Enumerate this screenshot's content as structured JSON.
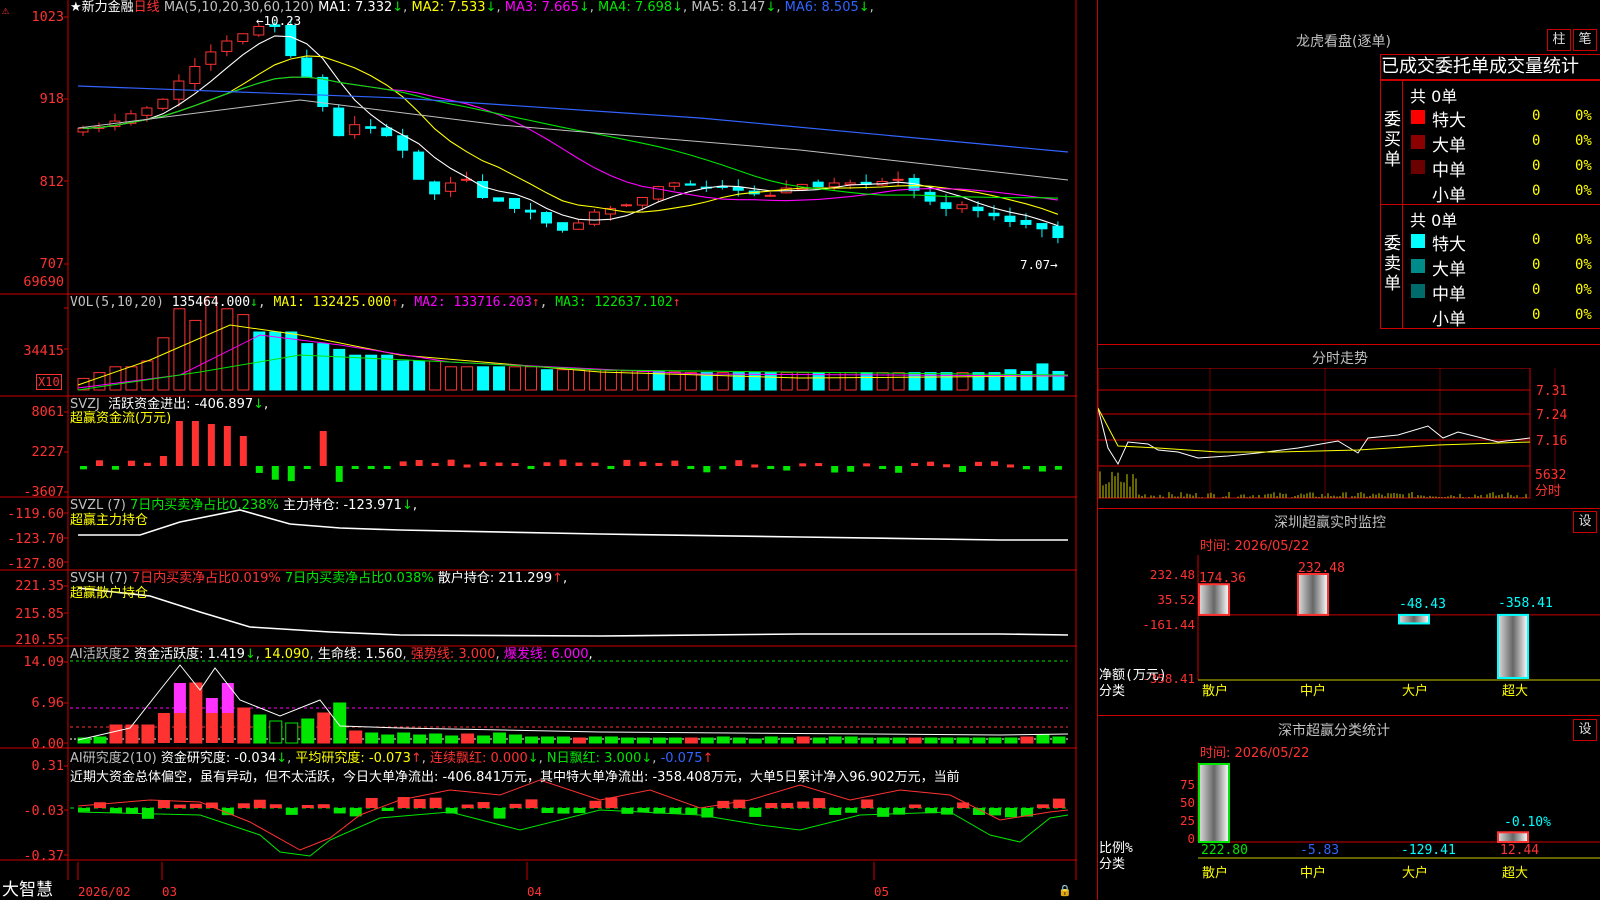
{
  "stock": {
    "star": "★",
    "name": "新力金融",
    "period": "日线"
  },
  "main": {
    "ma_title": "MA(5,10,20,30,60,120)",
    "ma": [
      {
        "label": "MA1: 7.332",
        "arrow": "↓",
        "color": "#ffffff"
      },
      {
        "label": "MA2: 7.533",
        "arrow": "↓",
        "color": "#ffff00"
      },
      {
        "label": "MA3: 7.665",
        "arrow": "↓",
        "color": "#ff00ff"
      },
      {
        "label": "MA4: 7.698",
        "arrow": "↓",
        "color": "#00e600"
      },
      {
        "label": "MA5: 8.147",
        "arrow": "↓",
        "color": "#c0c0c0"
      },
      {
        "label": "MA6: 8.505",
        "arrow": "↓",
        "color": "#3264ff"
      }
    ],
    "y_ticks": [
      "1023",
      "918",
      "812",
      "707"
    ],
    "high_label": "10.23",
    "low_label": "7.07",
    "corner_icon": "alert-icon"
  },
  "vol": {
    "title": "VOL(5,10,20)",
    "value": "135464.000",
    "v_arrow": "↓",
    "ma1": "MA1: 132425.000",
    "ma1_arrow": "↑",
    "ma2": "MA2: 133716.203",
    "ma2_arrow": "↑",
    "ma3": "MA3: 122637.102",
    "ma3_arrow": "↑",
    "y_ticks": [
      "69690",
      "34415"
    ],
    "unit": "X10"
  },
  "svzj": {
    "title": "SVZJ",
    "label": "活跃资金进出: -406.897",
    "arrow": "↓",
    "suffix": ",",
    "subtitle": "超赢资金流(万元)",
    "y_ticks": [
      "8061",
      "2227",
      "-3607"
    ]
  },
  "svzl": {
    "title": "SVZL (7)",
    "label1": "7日内买卖净占比0.238%",
    "label2": "主力持仓: -123.971",
    "arrow": "↓",
    "suffix": ",",
    "subtitle": "超赢主力持仓",
    "y_ticks": [
      "-119.60",
      "-123.70",
      "-127.80"
    ]
  },
  "svsh": {
    "title": "SVSH (7)",
    "label1": "7日内买卖净占比0.019%",
    "label2": "7日内买卖净占比0.038%",
    "label3": "散户持仓: 211.299",
    "arrow": "↑",
    "suffix": ",",
    "subtitle": "超赢散户持仓",
    "y_ticks": [
      "221.35",
      "215.85",
      "210.55"
    ]
  },
  "ai1": {
    "title": "AI活跃度2",
    "l1": "资金活跃度: 1.419",
    "l1a": "↓",
    "l2": "14.090",
    "l3": "生命线: 1.560",
    "l4": "强势线: 3.000",
    "l5": "爆发线: 6.000",
    "suffix": ",",
    "y_ticks": [
      "14.09",
      "6.96",
      "0.00"
    ]
  },
  "ai2": {
    "title": "AI研究度2(10)",
    "l1": "资金研究度: -0.034",
    "l1a": "↓",
    "l2": "平均研究度: -0.073",
    "l2a": "↑",
    "l3": "连续飘红: 0.000",
    "l3a": "↓",
    "l4": "N日飘红: 3.000",
    "l4a": "↓",
    "l5": "-0.075",
    "l5a": "↑",
    "note": "近期大资金总体偏空，虽有异动，但不太活跃，今日大单净流出: -406.841万元，其中特大单净流出: -358.408万元，大单5日累计净入96.902万元，当前",
    "y_ticks": [
      "0.31",
      "-0.03",
      "-0.37"
    ]
  },
  "xaxis": {
    "brand": "大智慧",
    "labels": [
      "2026/02",
      "03",
      "04",
      "05"
    ]
  },
  "right": {
    "lhb_title": "龙虎看盘(逐单)",
    "btn_bar": "柱",
    "btn_bi": "笔",
    "tab_text": "已成交委托单成交量统计",
    "buy_side": "委买单",
    "sell_side": "委卖单",
    "buy_total": "共 0单",
    "sell_total": "共 0单",
    "buy_rows": [
      {
        "name": "特大",
        "num": "0",
        "pct": "0%",
        "color": "#ff0000"
      },
      {
        "name": "大单",
        "num": "0",
        "pct": "0%",
        "color": "#8b0000"
      },
      {
        "name": "中单",
        "num": "0",
        "pct": "0%",
        "color": "#6b0000"
      },
      {
        "name": "小单",
        "num": "0",
        "pct": "0%",
        "color": "#000000"
      }
    ],
    "sell_rows": [
      {
        "name": "特大",
        "num": "0",
        "pct": "0%",
        "color": "#00ffff"
      },
      {
        "name": "大单",
        "num": "0",
        "pct": "0%",
        "color": "#008b8b"
      },
      {
        "name": "中单",
        "num": "0",
        "pct": "0%",
        "color": "#006b6b"
      },
      {
        "name": "小单",
        "num": "0",
        "pct": "0%",
        "color": "#000000"
      }
    ],
    "fs_title": "分时走势",
    "fs_ticks": [
      "7.31",
      "7.24",
      "7.16"
    ],
    "fs_vol": "5632",
    "fs_vol_label": "分时",
    "monitor_title": "深圳超赢实时监控",
    "monitor_set": "设",
    "monitor_time": "时间: 2026/05/22",
    "monitor_ticks": [
      "232.48",
      "35.52",
      "-161.44",
      "-358.41"
    ],
    "monitor_unit": "净额(万元)",
    "monitor_cls": "分类",
    "monitor_values": [
      174.36,
      232.48,
      -48.43,
      -358.41
    ],
    "monitor_value_labels": [
      "174.36",
      "232.48",
      "-48.43",
      "-358.41"
    ],
    "categories": [
      "散户",
      "中户",
      "大户",
      "超大"
    ],
    "stat_title": "深市超赢分类统计",
    "stat_set": "设",
    "stat_time": "时间: 2026/05/22",
    "stat_ticks": [
      "75",
      "50",
      "25",
      "0"
    ],
    "stat_unit": "比例%",
    "stat_cls": "分类",
    "stat_bar_values": [
      100,
      0,
      0,
      12.44
    ],
    "stat_value_labels": [
      "222.80",
      "-5.83",
      "-129.41",
      "12.44"
    ],
    "stat_extra": "-0.10%"
  }
}
